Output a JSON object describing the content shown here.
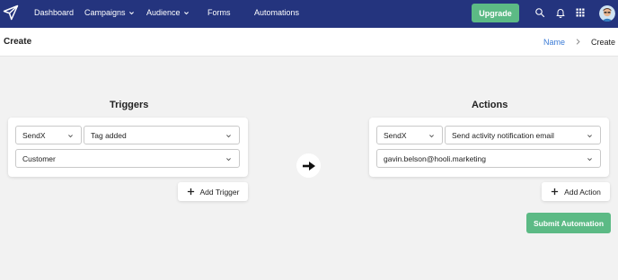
{
  "nav": {
    "items": [
      {
        "label": "Dashboard",
        "has_dropdown": false
      },
      {
        "label": "Campaigns",
        "has_dropdown": true
      },
      {
        "label": "Audience",
        "has_dropdown": true
      },
      {
        "label": "Forms",
        "has_dropdown": false
      },
      {
        "label": "Automations",
        "has_dropdown": false
      }
    ],
    "upgrade_label": "Upgrade",
    "icons": [
      "paper-plane-logo-icon",
      "search-icon",
      "bell-icon",
      "grid-apps-icon",
      "avatar"
    ]
  },
  "header": {
    "title": "Create",
    "breadcrumb": {
      "link": "Name",
      "current": "Create"
    }
  },
  "triggers": {
    "title": "Triggers",
    "source": "SendX",
    "event": "Tag added",
    "value": "Customer",
    "add_label": "Add Trigger"
  },
  "actions": {
    "title": "Actions",
    "source": "SendX",
    "action": "Send activity notification email",
    "value": "gavin.belson@hooli.marketing",
    "add_label": "Add Action"
  },
  "submit_label": "Submit Automation",
  "colors": {
    "nav_bg": "#24347e",
    "accent_green": "#5cba85",
    "link_blue": "#3b7bd6",
    "page_bg": "#f2f2f2"
  }
}
